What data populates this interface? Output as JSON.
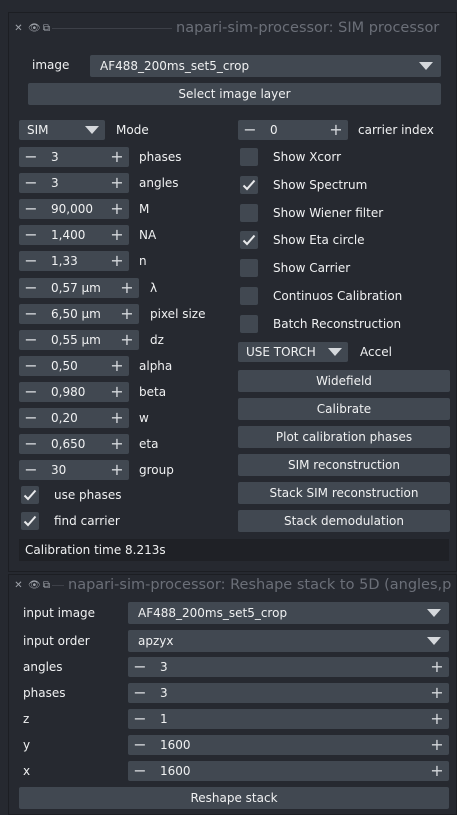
{
  "dock1": {
    "title": "napari-sim-processor: SIM processor",
    "image_label": "image",
    "image_value": "AF488_200ms_set5_crop",
    "select_layer_button": "Select image layer",
    "mode_value": "SIM",
    "mode_label": "Mode",
    "carrier_index": {
      "value": "0",
      "label": "carrier index"
    },
    "params": [
      {
        "value": "3",
        "label": "phases"
      },
      {
        "value": "3",
        "label": "angles"
      },
      {
        "value": "90,000",
        "label": "M"
      },
      {
        "value": "1,400",
        "label": "NA"
      },
      {
        "value": "1,33",
        "label": "n"
      },
      {
        "value": "0,57 µm",
        "label": "λ"
      },
      {
        "value": "6,50 µm",
        "label": "pixel size"
      },
      {
        "value": "0,55 µm",
        "label": "dz"
      },
      {
        "value": "0,50",
        "label": "alpha"
      },
      {
        "value": "0,980",
        "label": "beta"
      },
      {
        "value": "0,20",
        "label": "w"
      },
      {
        "value": "0,650",
        "label": "eta"
      },
      {
        "value": "30",
        "label": "group"
      }
    ],
    "left_checks": [
      {
        "label": "use phases",
        "checked": true
      },
      {
        "label": "find carrier",
        "checked": true
      }
    ],
    "right_checks": [
      {
        "label": "Show Xcorr",
        "checked": false
      },
      {
        "label": "Show Spectrum",
        "checked": true
      },
      {
        "label": "Show Wiener filter",
        "checked": false
      },
      {
        "label": "Show Eta circle",
        "checked": true
      },
      {
        "label": "Show Carrier",
        "checked": false
      },
      {
        "label": "Continuos Calibration",
        "checked": false
      },
      {
        "label": "Batch Reconstruction",
        "checked": false
      }
    ],
    "accel_value": "USE TORCH",
    "accel_label": "Accel",
    "buttons": [
      "Widefield",
      "Calibrate",
      "Plot calibration phases",
      "SIM reconstruction",
      "Stack SIM reconstruction",
      "Stack demodulation"
    ],
    "status": "Calibration time 8.213s"
  },
  "dock2": {
    "title": "napari-sim-processor: Reshape stack to 5D (angles,p",
    "input_image_label": "input image",
    "input_image_value": "AF488_200ms_set5_crop",
    "input_order_label": "input order",
    "input_order_value": "apzyx",
    "dims": [
      {
        "label": "angles",
        "value": "3"
      },
      {
        "label": "phases",
        "value": "3"
      },
      {
        "label": "z",
        "value": "1"
      },
      {
        "label": "y",
        "value": "1600"
      },
      {
        "label": "x",
        "value": "1600"
      }
    ],
    "reshape_button": "Reshape stack"
  },
  "colors": {
    "background": "#262930",
    "widget": "#414851",
    "status_bg": "#1f2126",
    "title_text": "#6b6f78"
  }
}
